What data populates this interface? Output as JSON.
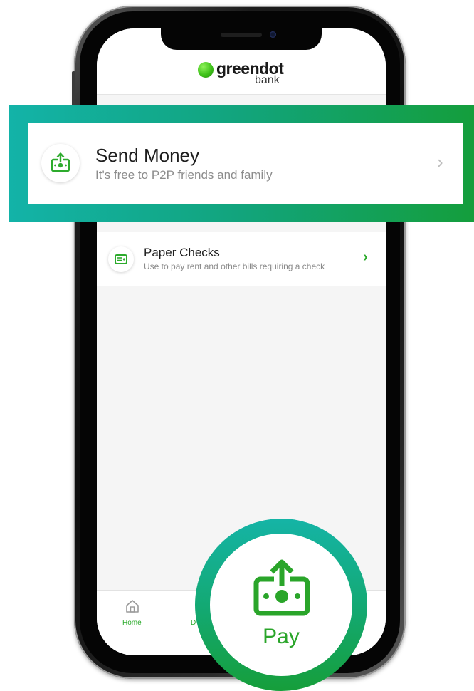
{
  "header": {
    "logo_word": "greendot",
    "logo_sub": "bank"
  },
  "send_money": {
    "title": "Send Money",
    "subtitle": "It's free to P2P friends and family",
    "chevron": "›",
    "icon": "send-money-icon"
  },
  "paper_checks": {
    "title": "Paper Checks",
    "subtitle": "Use to pay rent and other bills requiring a check",
    "chevron": "›",
    "icon": "check-icon"
  },
  "bottom_nav": {
    "home_label": "Home",
    "partial_label": "D",
    "home_icon": "home-icon"
  },
  "pay": {
    "label": "Pay",
    "icon": "pay-icon"
  },
  "colors": {
    "brand_green": "#2dab2d",
    "callout_teal": "#13b3a8",
    "callout_green": "#149e3c"
  }
}
